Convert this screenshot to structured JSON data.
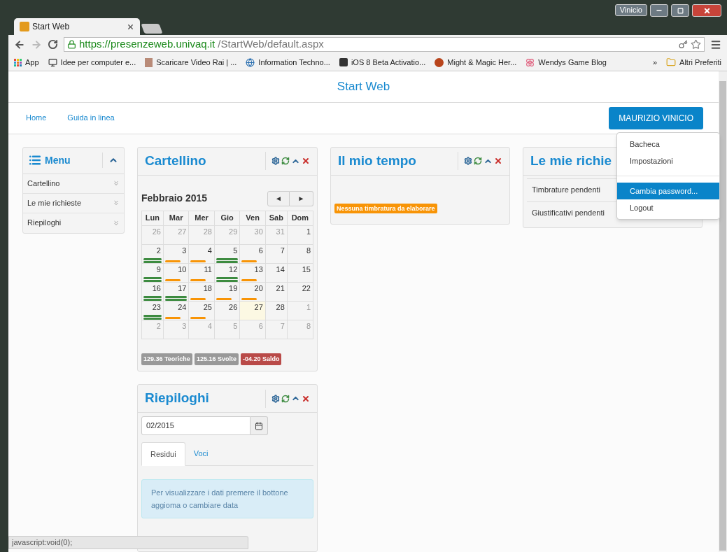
{
  "browser": {
    "profile": "Vinicio",
    "tabs": [
      {
        "title": "Start Web",
        "selected": true
      }
    ],
    "url_host": "https://presenzeweb.univaq.it",
    "url_path": "/StartWeb/default.aspx",
    "bookmarks": [
      "App",
      "Idee per computer e...",
      "Scaricare Video Rai | ...",
      "Information Techno...",
      "iOS 8 Beta Activatio...",
      "Might & Magic Her...",
      "Wendys Game Blog"
    ],
    "overflow": "»",
    "other_bookmarks": "Altri Preferiti"
  },
  "page": {
    "title": "Start Web",
    "nav": [
      "Home",
      "Guida in linea"
    ],
    "user_button": "MAURIZIO VINICIO",
    "user_menu": [
      {
        "label": "Bacheca",
        "selected": false
      },
      {
        "label": "Impostazioni",
        "selected": false
      },
      {
        "kind": "divider"
      },
      {
        "label": "Cambia password...",
        "selected": true
      },
      {
        "label": "Logout",
        "selected": false
      }
    ]
  },
  "menu": {
    "title": "Menu",
    "items": [
      "Cartellino",
      "Le mie richieste",
      "Riepiloghi"
    ]
  },
  "cartellino": {
    "title": "Cartellino",
    "month": "Febbraio 2015",
    "prev": "◄",
    "next": "►",
    "weekdays": [
      "Lun",
      "Mar",
      "Mer",
      "Gio",
      "Ven",
      "Sab",
      "Dom"
    ],
    "weeks": [
      [
        {
          "day": "26",
          "muted": true
        },
        {
          "day": "27",
          "muted": true
        },
        {
          "day": "28",
          "muted": true
        },
        {
          "day": "29",
          "muted": true
        },
        {
          "day": "30",
          "muted": true
        },
        {
          "day": "31",
          "muted": true
        },
        {
          "day": "1",
          "muted": false
        }
      ],
      [
        {
          "day": "2",
          "muted": false,
          "kind": "full"
        },
        {
          "day": "3",
          "muted": false,
          "kind": "partial"
        },
        {
          "day": "4",
          "muted": false,
          "kind": "partial"
        },
        {
          "day": "5",
          "muted": false,
          "kind": "full"
        },
        {
          "day": "6",
          "muted": false,
          "kind": "partial"
        },
        {
          "day": "7",
          "muted": false
        },
        {
          "day": "8",
          "muted": false
        }
      ],
      [
        {
          "day": "9",
          "muted": false,
          "kind": "full"
        },
        {
          "day": "10",
          "muted": false,
          "kind": "partial"
        },
        {
          "day": "11",
          "muted": false,
          "kind": "partial"
        },
        {
          "day": "12",
          "muted": false,
          "kind": "full"
        },
        {
          "day": "13",
          "muted": false,
          "kind": "partial"
        },
        {
          "day": "14",
          "muted": false
        },
        {
          "day": "15",
          "muted": false
        }
      ],
      [
        {
          "day": "16",
          "muted": false,
          "kind": "full"
        },
        {
          "day": "17",
          "muted": false,
          "kind": "full"
        },
        {
          "day": "18",
          "muted": false,
          "kind": "partial"
        },
        {
          "day": "19",
          "muted": false,
          "kind": "partial"
        },
        {
          "day": "20",
          "muted": false,
          "kind": "partial"
        },
        {
          "day": "21",
          "muted": false
        },
        {
          "day": "22",
          "muted": false
        }
      ],
      [
        {
          "day": "23",
          "muted": false,
          "kind": "full"
        },
        {
          "day": "24",
          "muted": false,
          "kind": "partial"
        },
        {
          "day": "25",
          "muted": false,
          "kind": "partial"
        },
        {
          "day": "26",
          "muted": false
        },
        {
          "day": "27",
          "muted": false,
          "today": true
        },
        {
          "day": "28",
          "muted": false
        },
        {
          "day": "1",
          "muted": true
        }
      ],
      [
        {
          "day": "2",
          "muted": true
        },
        {
          "day": "3",
          "muted": true
        },
        {
          "day": "4",
          "muted": true
        },
        {
          "day": "5",
          "muted": true
        },
        {
          "day": "6",
          "muted": true
        },
        {
          "day": "7",
          "muted": true
        },
        {
          "day": "8",
          "muted": true
        }
      ]
    ],
    "totals": [
      {
        "text": "129.36 Teoriche",
        "color": "#999999"
      },
      {
        "text": "125.16 Svolte",
        "color": "#999999"
      },
      {
        "text": "-04.20 Saldo",
        "color": "#b94a48"
      }
    ]
  },
  "mio_tempo": {
    "title": "Il mio tempo",
    "badge": "Nessuna timbratura da elaborare"
  },
  "richieste": {
    "title": "Le mie richie",
    "rows": [
      "Timbrature pendenti",
      "Giustificativi pendenti"
    ]
  },
  "riepiloghi": {
    "title": "Riepiloghi",
    "date": "02/2015",
    "tabs": [
      {
        "label": "Residui",
        "selected": true
      },
      {
        "label": "Voci",
        "selected": false
      }
    ],
    "info": "Per visualizzare i dati premere il bottone aggioma o cambiare data"
  },
  "status_bar": "javascript:void(0);"
}
